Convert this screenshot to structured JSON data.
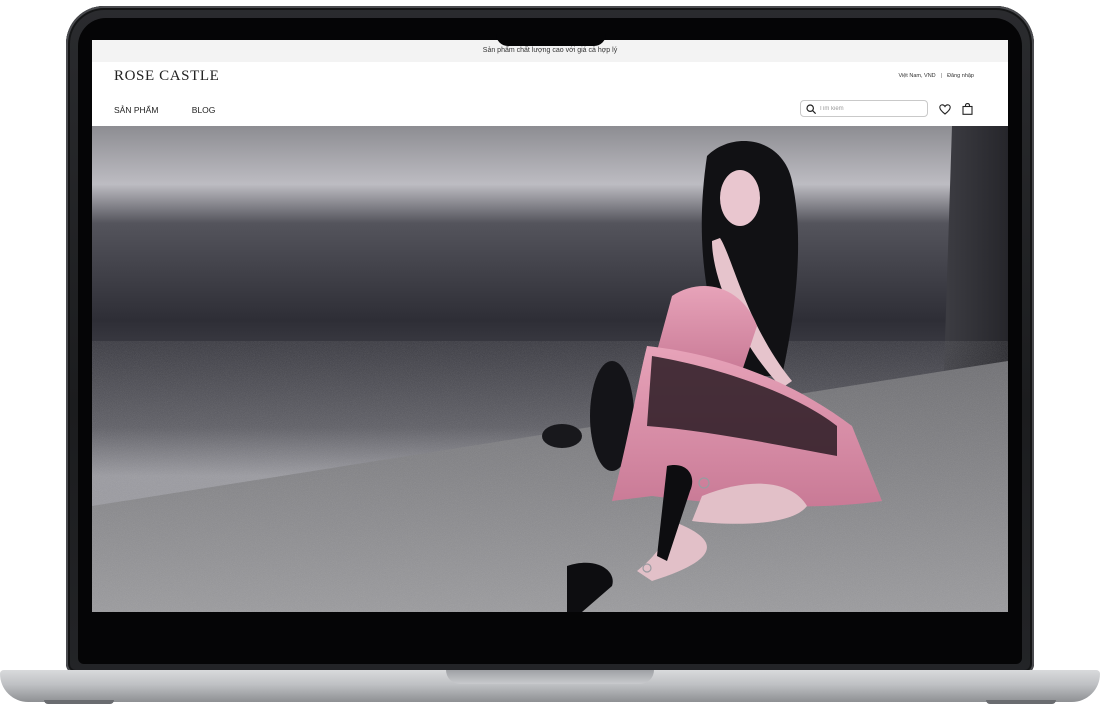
{
  "announcement": "Sản phẩm chất lượng cao với giá cả hợp lý",
  "brand": {
    "name": "ROSE CASTLE"
  },
  "top_bar": {
    "region": "Việt Nam, VND",
    "separator": "|",
    "login": "Đăng nhập"
  },
  "nav": {
    "items": [
      {
        "label": "SẢN PHẨM"
      },
      {
        "label": "BLOG"
      }
    ]
  },
  "search": {
    "placeholder": "Tìm kiếm",
    "value": ""
  },
  "icons": {
    "search": "search-icon",
    "wishlist": "heart-icon",
    "cart": "shopping-bag-icon"
  },
  "hero": {
    "image": "editorial photo: woman with long dark hair in pink pleated dress sitting on concrete floor"
  },
  "colors": {
    "accent_pink": "#d98aa6",
    "text": "#222222",
    "announce_bg": "#f3f3f3"
  }
}
